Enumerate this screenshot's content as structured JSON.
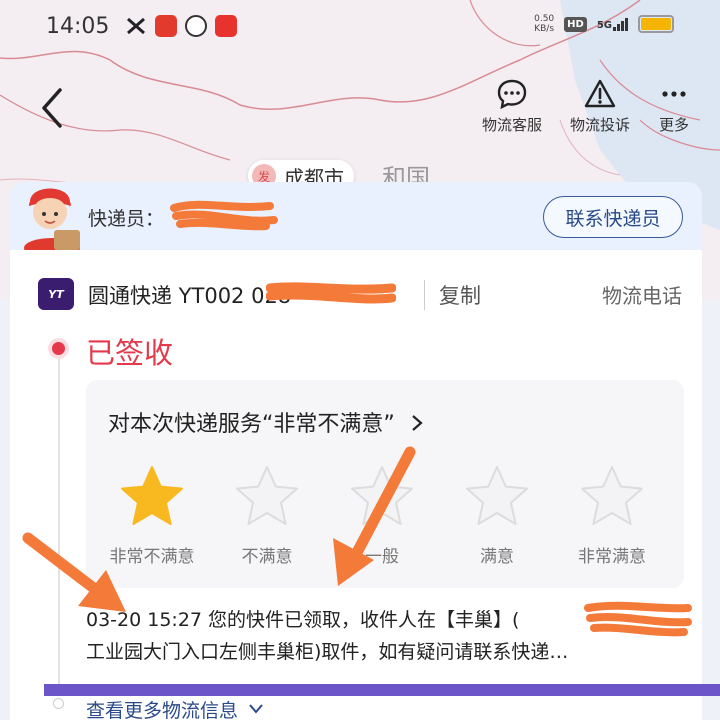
{
  "status_bar": {
    "time": "14:05",
    "app_icons": [
      "tiktok-icon",
      "toutiao-icon",
      "hand-icon",
      "video-icon"
    ],
    "net_speed_value": "0.50",
    "net_speed_unit": "KB/s",
    "hd_label": "HD",
    "network_label": "5G",
    "battery_level": 1.0
  },
  "nav": {
    "actions": [
      {
        "label": "物流客服",
        "icon": "chat-icon"
      },
      {
        "label": "物流投诉",
        "icon": "warning-icon"
      },
      {
        "label": "更多",
        "icon": "more-dots-icon"
      }
    ]
  },
  "map": {
    "city_badge": "发",
    "city_label": "成都市",
    "country_label": "和国"
  },
  "courier": {
    "label": "快递员：",
    "contact_button": "联系快递员"
  },
  "shipment": {
    "logo_text": "YT",
    "carrier_line": "圆通快递 YT002                 028",
    "copy_label": "复制",
    "phone_label": "物流电话",
    "status": "已签收"
  },
  "rating": {
    "prompt": "对本次快递服务“非常不满意”",
    "selected_index": 0,
    "options": [
      "非常不满意",
      "不满意",
      "一般",
      "满意",
      "非常满意"
    ]
  },
  "detail": {
    "line1": "03-20 15:27 您的快件已领取，收件人在【丰巢】(",
    "line2": "工业园大门入口左侧丰巢柜)取件，如有疑问请联系快递…"
  },
  "more_info": "查看更多物流信息"
}
